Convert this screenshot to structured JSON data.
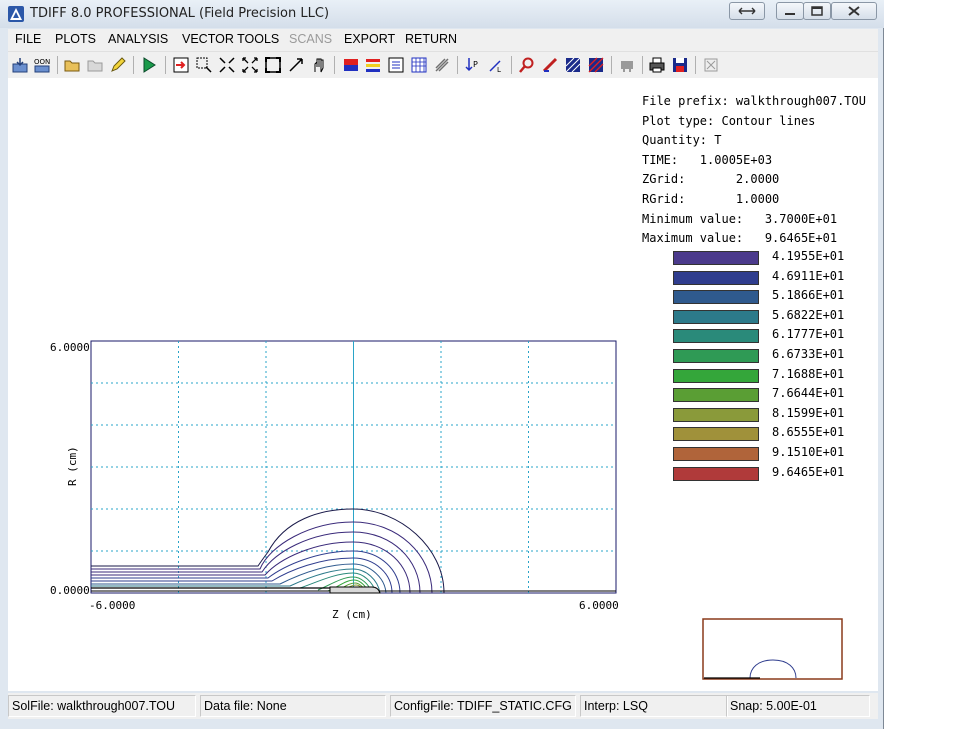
{
  "window": {
    "title": "TDIFF 8.0 PROFESSIONAL (Field Precision LLC)",
    "app_icon": "triangle-app-icon",
    "controls": [
      "restore-icon",
      "minimize-icon",
      "maximize-icon",
      "close-icon"
    ]
  },
  "menu": {
    "items": [
      {
        "label": "FILE",
        "enabled": true
      },
      {
        "label": "PLOTS",
        "enabled": true
      },
      {
        "label": "ANALYSIS",
        "enabled": true
      },
      {
        "label": "VECTOR TOOLS",
        "enabled": true
      },
      {
        "label": "SCANS",
        "enabled": false
      },
      {
        "label": "EXPORT",
        "enabled": true
      },
      {
        "label": "RETURN",
        "enabled": true
      }
    ]
  },
  "toolbar": {
    "icons": [
      "load-solution-icon",
      "on-icon",
      "open-folder-icon",
      "open-folder-disabled-icon",
      "pencil-icon",
      "run-icon",
      "export-plot-icon",
      "zoom-window-icon",
      "zoom-in-icon",
      "zoom-out-icon",
      "full-view-icon",
      "pan-icon",
      "hand-icon",
      "element-plot-icon",
      "contour-plot-icon",
      "filled-contour-icon",
      "surface-plot-icon",
      "field-lines-icon",
      "point-probe-icon",
      "line-scan-icon",
      "search-icon",
      "vector-icon",
      "grid-icon",
      "element-grid-icon",
      "settings-icon",
      "print-icon",
      "save-icon",
      "close-plot-icon"
    ]
  },
  "info": {
    "file_prefix": "File prefix: walkthrough007.TOU",
    "plot_type": "Plot type: Contour lines",
    "quantity": "Quantity: T",
    "time": "TIME:   1.0005E+03",
    "zgrid": "ZGrid:       2.0000",
    "rgrid": "RGrid:       1.0000",
    "min": "Minimum value:   3.7000E+01",
    "max": "Maximum value:   9.6465E+01"
  },
  "legend": [
    {
      "label": "4.1955E+01",
      "color": "#4b3a8c"
    },
    {
      "label": "4.6911E+01",
      "color": "#2f3d8e"
    },
    {
      "label": "5.1866E+01",
      "color": "#2f5a8e"
    },
    {
      "label": "5.6822E+01",
      "color": "#2c7a8a"
    },
    {
      "label": "6.1777E+01",
      "color": "#2a8a7a"
    },
    {
      "label": "6.6733E+01",
      "color": "#2f9a55"
    },
    {
      "label": "7.1688E+01",
      "color": "#34a63a"
    },
    {
      "label": "7.6644E+01",
      "color": "#5a9e34"
    },
    {
      "label": "8.1599E+01",
      "color": "#8a9a3a"
    },
    {
      "label": "8.6555E+01",
      "color": "#a0913a"
    },
    {
      "label": "9.1510E+01",
      "color": "#b0643a"
    },
    {
      "label": "9.6465E+01",
      "color": "#b03a3a"
    }
  ],
  "plot": {
    "ymax_label": "6.0000",
    "ymin_label": "0.0000",
    "xmin_label": "-6.0000",
    "xmax_label": "6.0000",
    "xlabel": "Z (cm)",
    "ylabel": "R (cm)"
  },
  "status": {
    "solfile": "SolFile: walkthrough007.TOU",
    "datafile": "Data file: None",
    "configfile": "ConfigFile: TDIFF_STATIC.CFG",
    "interp": "Interp: LSQ",
    "snap": "Snap:  5.00E-01"
  }
}
